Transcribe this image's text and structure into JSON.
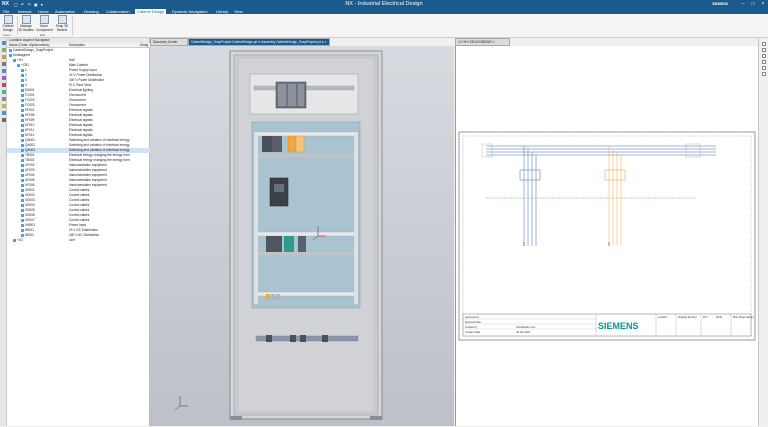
{
  "app": {
    "logo": "NX",
    "title": "NX - Industrial Electrical Design",
    "brand": "SIEMENS"
  },
  "menu": [
    "File",
    "Internal",
    "Home",
    "Automation",
    "Drawing",
    "Collaboration",
    "Cabinet Design",
    "Dynamic Navigation",
    "Library",
    "View"
  ],
  "menu_active_index": 6,
  "ribbon": {
    "buttons": [
      {
        "label": "Cabinet Design"
      },
      {
        "label": "Manage 3D Models"
      },
      {
        "label": "Move Component"
      },
      {
        "label": "Snap 3D Models"
      }
    ],
    "groups": [
      "Insert",
      "Edit"
    ]
  },
  "navigator": {
    "title": "Location Aspect Navigator",
    "columns": [
      "Name (Order, Alphanumeric)",
      "Description",
      "Desig"
    ],
    "rows": [
      {
        "name": "CabinetDesign_SnapProject",
        "desc": "",
        "level": 0
      },
      {
        "name": "Unassigned",
        "desc": "",
        "level": 0
      },
      {
        "name": "+H1",
        "desc": "Hall",
        "level": 1
      },
      {
        "name": "+CB1",
        "desc": "Main Cabinet",
        "level": 2
      },
      {
        "name": "1",
        "desc": "Power Supply Input",
        "level": 3
      },
      {
        "name": "2",
        "desc": "24 V Power Distribution",
        "level": 3
      },
      {
        "name": "3",
        "desc": "400 V Power Distribution",
        "level": 3
      },
      {
        "name": "4",
        "desc": "PLC Rack View",
        "level": 3
      },
      {
        "name": "EA001",
        "desc": "Electrical lighting",
        "level": 3
      },
      {
        "name": "FC001",
        "desc": "Overcurrent",
        "level": 3
      },
      {
        "name": "FC002",
        "desc": "Overcurrent",
        "level": 3
      },
      {
        "name": "FC003",
        "desc": "Overcurrent",
        "level": 3
      },
      {
        "name": "KF001",
        "desc": "Electrical signals",
        "level": 3
      },
      {
        "name": "KF008",
        "desc": "Electrical signals",
        "level": 3
      },
      {
        "name": "KF009",
        "desc": "Electrical signals",
        "level": 3
      },
      {
        "name": "KF010",
        "desc": "Electrical signals",
        "level": 3
      },
      {
        "name": "KF011",
        "desc": "Electrical signals",
        "level": 3
      },
      {
        "name": "KF012",
        "desc": "Electrical signals",
        "level": 3
      },
      {
        "name": "QA001",
        "desc": "Switching and variation of electrical energy",
        "level": 3
      },
      {
        "name": "QA002",
        "desc": "Switching and variation of electrical energy",
        "level": 3
      },
      {
        "name": "QA003",
        "desc": "Switching and variation of electrical energy",
        "level": 3,
        "selected": true
      },
      {
        "name": "TB001",
        "desc": "Electrical energy changing the energy form",
        "level": 3
      },
      {
        "name": "TB002",
        "desc": "Electrical energy changing the energy form",
        "level": 3
      },
      {
        "name": "UF002",
        "desc": "Instrumentation equipment",
        "level": 3
      },
      {
        "name": "UF003",
        "desc": "Instrumentation equipment",
        "level": 3
      },
      {
        "name": "UF004",
        "desc": "Instrumentation equipment",
        "level": 3
      },
      {
        "name": "UF005",
        "desc": "Instrumentation equipment",
        "level": 3
      },
      {
        "name": "UF006",
        "desc": "Instrumentation equipment",
        "level": 3
      },
      {
        "name": "XD001",
        "desc": "Control cables",
        "level": 3
      },
      {
        "name": "XD002",
        "desc": "Control cables",
        "level": 3
      },
      {
        "name": "XD003",
        "desc": "Control cables",
        "level": 3
      },
      {
        "name": "XD004",
        "desc": "Control cables",
        "level": 3
      },
      {
        "name": "XD005",
        "desc": "Control cables",
        "level": 3
      },
      {
        "name": "XD006",
        "desc": "Control cables",
        "level": 3
      },
      {
        "name": "XD007",
        "desc": "Control cables",
        "level": 3
      },
      {
        "name": "XM001",
        "desc": "Power Input",
        "level": 3
      },
      {
        "name": "WD01",
        "desc": "24 V DC Distribution",
        "level": 3
      },
      {
        "name": "WD02",
        "desc": "400 V AC Distribution",
        "level": 3
      },
      {
        "name": "+U1",
        "desc": "Line",
        "level": 1
      }
    ]
  },
  "tabs": [
    {
      "label": "Discovery Center",
      "active": false
    },
    {
      "label": "CabinetDesign_SnapProject:CabinetDesign.prt in Assembly CabinetDesign_SnapProject.prt ● ×",
      "active": true
    },
    {
      "label": "1C+H1+CB1/2/CBDWG ×",
      "active": false
    }
  ],
  "drawing": {
    "logo": "SIEMENS",
    "tb_labels": [
      "Approved by",
      "Approval Date",
      "Created by",
      "Creation Date",
      "Check"
    ],
    "tb_values": [
      "JohnMueller User",
      "09-Jan-2023",
      "Location",
      "Drawing Number",
      "DT1",
      "NX11",
      "Plan (Page Name)"
    ]
  },
  "colors": {
    "accent": "#1b5a8c",
    "orange": "#f2a640",
    "green": "#6ab04c",
    "blue_schematic": "#3b6fb6",
    "siemens": "#009999"
  }
}
